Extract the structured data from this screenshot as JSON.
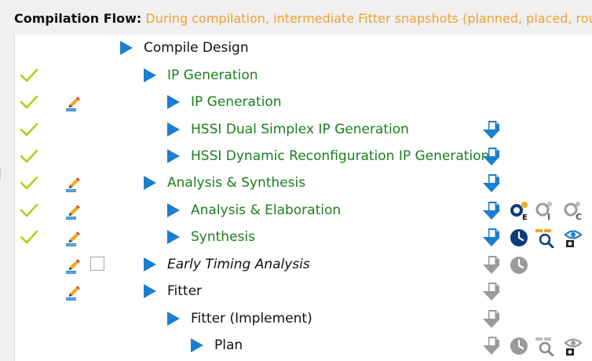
{
  "header": {
    "label": "Compilation Flow:",
    "message": " During compilation, intermediate Fitter snapshots (planned, placed, rout"
  },
  "colors": {
    "accent_blue": "#1a7fd0",
    "done_green": "#1b7f1b",
    "check_lime": "#b8cc14",
    "header_orange": "#f0a030"
  },
  "tasks": [
    {
      "label": "Compile Design",
      "status": "none",
      "edit": false,
      "checkbox": false,
      "style": "normal",
      "icons": []
    },
    {
      "label": "IP Generation",
      "status": "done",
      "edit": false,
      "checkbox": false,
      "style": "done",
      "icons": []
    },
    {
      "label": "IP Generation",
      "status": "done",
      "edit": true,
      "checkbox": false,
      "style": "done",
      "icons": []
    },
    {
      "label": "HSSI Dual Simplex IP Generation",
      "status": "done",
      "edit": false,
      "checkbox": false,
      "style": "done",
      "icons": [
        "report-icon"
      ]
    },
    {
      "label": "HSSI Dynamic Reconfiguration IP Generation",
      "status": "done",
      "edit": false,
      "checkbox": false,
      "style": "done",
      "icons": [
        "report-icon"
      ]
    },
    {
      "label": "Analysis & Synthesis",
      "status": "done",
      "edit": true,
      "checkbox": false,
      "style": "done",
      "icons": [
        "report-icon"
      ]
    },
    {
      "label": "Analysis & Elaboration",
      "status": "done",
      "edit": true,
      "checkbox": false,
      "style": "done",
      "icons": [
        "report-icon",
        "elaboration-viewer-icon",
        "inspect-i-icon",
        "inspect-c-icon"
      ]
    },
    {
      "label": "Synthesis",
      "status": "done",
      "edit": true,
      "checkbox": false,
      "style": "done",
      "icons": [
        "report-icon",
        "timing-icon",
        "netlist-viewer-icon",
        "snapshot-viewer-icon"
      ]
    },
    {
      "label": "Early Timing Analysis",
      "status": "none",
      "edit": true,
      "checkbox": true,
      "style": "optional",
      "icons": [
        "report-icon-disabled",
        "timing-icon-disabled"
      ]
    },
    {
      "label": "Fitter",
      "status": "none",
      "edit": true,
      "checkbox": false,
      "style": "normal",
      "icons": [
        "report-icon-disabled"
      ]
    },
    {
      "label": "Fitter (Implement)",
      "status": "none",
      "edit": false,
      "checkbox": false,
      "style": "normal",
      "icons": [
        "report-icon-disabled"
      ]
    },
    {
      "label": "Plan",
      "status": "none",
      "edit": false,
      "checkbox": false,
      "style": "normal",
      "icons": [
        "report-icon-disabled",
        "timing-icon-disabled",
        "netlist-viewer-icon-disabled",
        "snapshot-viewer-icon-disabled"
      ]
    }
  ]
}
